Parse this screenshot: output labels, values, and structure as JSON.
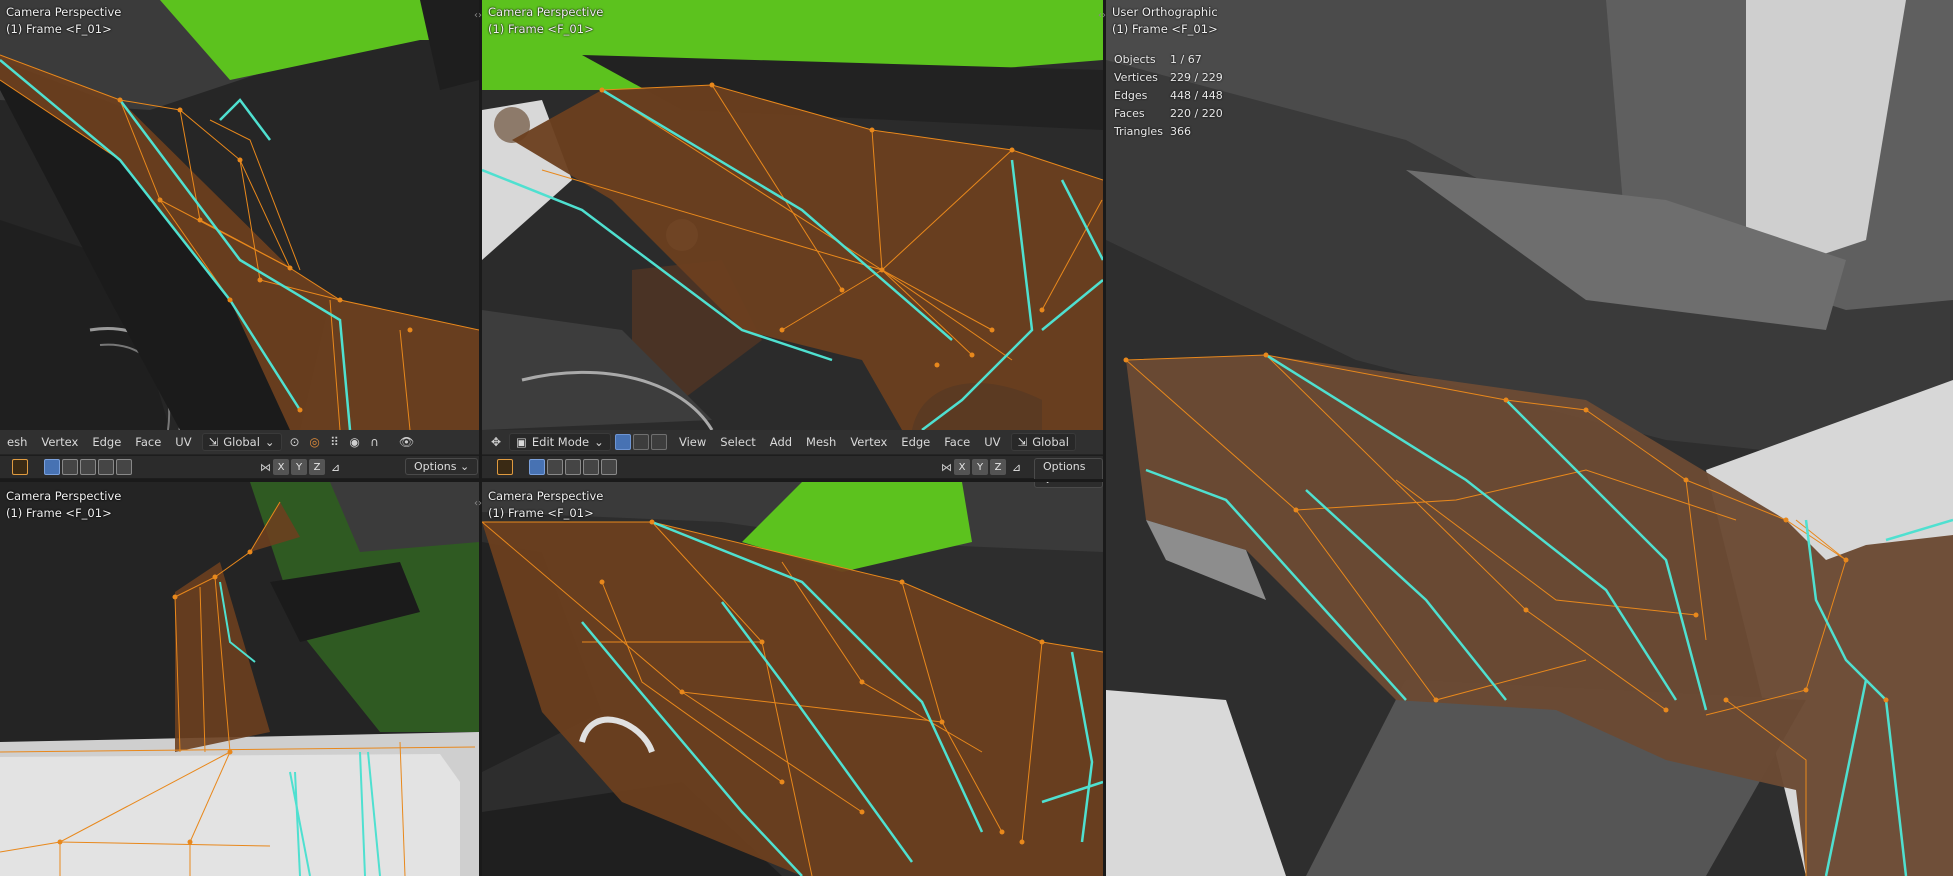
{
  "viewports": {
    "top_left": {
      "view": "Camera Perspective",
      "frame": "(1) Frame <F_01>"
    },
    "top_mid": {
      "view": "Camera Perspective",
      "frame": "(1) Frame <F_01>"
    },
    "bottom_left": {
      "view": "Camera Perspective",
      "frame": "(1) Frame <F_01>"
    },
    "bottom_mid": {
      "view": "Camera Perspective",
      "frame": "(1) Frame <F_01>"
    },
    "right": {
      "view": "User Orthographic",
      "frame": "(1) Frame <F_01>"
    }
  },
  "stats": [
    {
      "label": "Objects",
      "value": "1 / 67"
    },
    {
      "label": "Vertices",
      "value": "229 / 229"
    },
    {
      "label": "Edges",
      "value": "448 / 448"
    },
    {
      "label": "Faces",
      "value": "220 / 220"
    },
    {
      "label": "Triangles",
      "value": "366"
    }
  ],
  "header_left": {
    "menus": [
      "esh",
      "Vertex",
      "Edge",
      "Face",
      "UV"
    ],
    "orientation": "Global"
  },
  "header_mid": {
    "mode": "Edit Mode",
    "menus": [
      "View",
      "Select",
      "Add",
      "Mesh",
      "Vertex",
      "Edge",
      "Face",
      "UV"
    ],
    "orientation": "Global"
  },
  "toolbar": {
    "axes": [
      "X",
      "Y",
      "Z"
    ],
    "options_label": "Options"
  },
  "colors": {
    "mesh_fill": "#6b3f1f",
    "edge": "#e8881c",
    "seam": "#4fe0d0",
    "accent_green": "#5cc21e",
    "header_bg": "#303030"
  }
}
